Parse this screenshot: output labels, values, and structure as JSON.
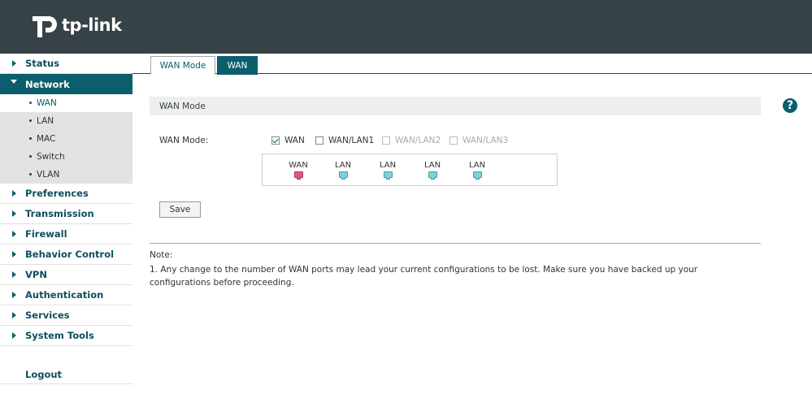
{
  "brand": {
    "name": "tp-link"
  },
  "colors": {
    "header_bg": "#364247",
    "accent": "#0b5e6c",
    "wan_port": "#d9578c",
    "lan_port": "#7fd1d6"
  },
  "sidebar": {
    "items": [
      {
        "label": "Status"
      },
      {
        "label": "Network"
      },
      {
        "label": "Preferences"
      },
      {
        "label": "Transmission"
      },
      {
        "label": "Firewall"
      },
      {
        "label": "Behavior Control"
      },
      {
        "label": "VPN"
      },
      {
        "label": "Authentication"
      },
      {
        "label": "Services"
      },
      {
        "label": "System Tools"
      }
    ],
    "network_subitems": [
      {
        "label": "WAN"
      },
      {
        "label": "LAN"
      },
      {
        "label": "MAC"
      },
      {
        "label": "Switch"
      },
      {
        "label": "VLAN"
      }
    ],
    "logout": "Logout"
  },
  "tabs": [
    {
      "label": "WAN Mode"
    },
    {
      "label": "WAN"
    }
  ],
  "section": {
    "title": "WAN Mode"
  },
  "form": {
    "wan_mode_label": "WAN Mode:",
    "options": [
      {
        "label": "WAN",
        "checked": true,
        "disabled": false
      },
      {
        "label": "WAN/LAN1",
        "checked": false,
        "disabled": false
      },
      {
        "label": "WAN/LAN2",
        "checked": false,
        "disabled": true
      },
      {
        "label": "WAN/LAN3",
        "checked": false,
        "disabled": true
      }
    ],
    "ports": [
      {
        "label": "WAN",
        "type": "wan"
      },
      {
        "label": "LAN",
        "type": "lan"
      },
      {
        "label": "LAN",
        "type": "lan"
      },
      {
        "label": "LAN",
        "type": "lan"
      },
      {
        "label": "LAN",
        "type": "lan"
      }
    ],
    "save_label": "Save"
  },
  "note": {
    "title": "Note:",
    "text": "1. Any change to the number of WAN ports may lead your current configurations to be lost. Make sure you have backed up your configurations before proceeding."
  },
  "help": {
    "glyph": "?"
  }
}
